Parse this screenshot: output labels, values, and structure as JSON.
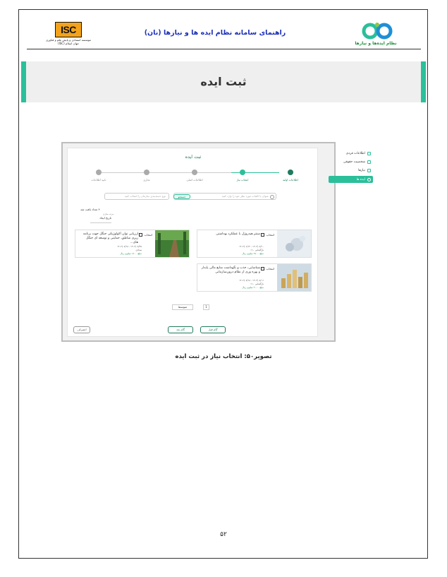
{
  "header": {
    "doc_title": "راهنمای سامانه نظام ایده ها و نیازها (نان)",
    "isc_logo_text": "ISC",
    "isc_caption": "موسسه استنادی و پایش علم و فناوری جهان اسلام (ISC)",
    "nan_caption": "نظام ایده‌ها و نیازها"
  },
  "section": {
    "title": "ثبت ایده"
  },
  "screenshot": {
    "panel_title": "ثبت ایده",
    "sidebar": [
      {
        "label": "اطلاعات فردی",
        "icon": "user-icon"
      },
      {
        "label": "شخصیت حقوقی",
        "icon": "building-icon"
      },
      {
        "label": "نیازها",
        "icon": "chat-icon"
      },
      {
        "label": "ایده ها",
        "icon": "lightbulb-icon"
      }
    ],
    "steps": [
      "اطلاعات اولیه",
      "انتخاب نیاز",
      "اطلاعات اصلی",
      "تجاری",
      "تایید اطلاعات"
    ],
    "search_placeholder": "عنوان یا کلمات مورد نظر خود را وارد کنید",
    "search_button": "جستجو",
    "select_placeholder": "نوع دسته‌بندی سازمان را انتخاب کنید",
    "sort_label": "تعداد یافت شد",
    "sort_count": "۴",
    "sort_caption": "مرتب سازی",
    "sort_value": "تاریخ ایجاد",
    "cards": [
      {
        "check": "انتخاب",
        "title": "سنتز هیدروژل با عملکرد بهداشتی",
        "meta1": "۱۴۰۲/۰۷/۱۰ - ۱۴۰۲/۰۶/۱۲",
        "meta2": "بازگشایی ۱۰٪",
        "meta3": "مبلغ: ۲۵۰۰ میلیون ریال"
      },
      {
        "check": "انتخاب",
        "title": "ارزیابی توان اکولوژیکی جنگل جهت برنامه ریزی مناطق، حمایتی و توسعه ای جنگل های...",
        "meta1": "۱۴۰۲/۰۸/۲۵ - ۱۴۰۲/۰۷/۱۸",
        "meta2": "ستادی",
        "meta3": "مبلغ: ۱۸۰۰ میلیون ریال"
      },
      {
        "check": "انتخاب",
        "title": "شناسایی، جذب و نگهداشت منابع مالی پایدار و بهره وری از نظام درون‌سازمانی",
        "meta1": "۱۴۰۲/۰۸/۰۶ - ۱۴۰۲/۰۷/۱۸",
        "meta2": "بازگشایی ۱۰٪",
        "meta3": "مبلغ: ۳۰۰۰ میلیون ریال"
      }
    ],
    "pagination": {
      "page": "1",
      "page_size": "متوسط"
    },
    "buttons": {
      "next": "گام بعد",
      "prev": "گام قبل",
      "cancel": "انصراف"
    }
  },
  "caption": "تصویر۵۰: انتخاب نیاز در ثبت ایده",
  "page_number": "۵۲",
  "colors": {
    "accent": "#2bbf9a",
    "dark_green": "#1f7a5e",
    "title_blue": "#1a2fb8",
    "isc_orange": "#f2a31b"
  }
}
